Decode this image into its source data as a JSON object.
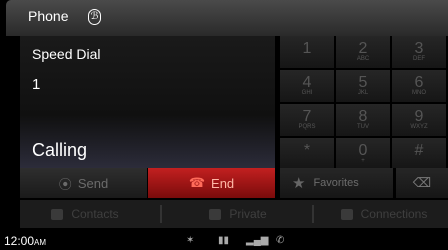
{
  "header": {
    "title": "Phone",
    "bluetooth_icon": "bluetooth-icon"
  },
  "left_panel": {
    "label": "Speed Dial",
    "number": "1",
    "status": "Calling"
  },
  "actions": {
    "send_label": "Send",
    "end_label": "End",
    "end_color": "#c22020"
  },
  "keypad": {
    "keys": [
      {
        "digit": "1",
        "letters": ""
      },
      {
        "digit": "2",
        "letters": "ABC"
      },
      {
        "digit": "3",
        "letters": "DEF"
      },
      {
        "digit": "4",
        "letters": "GHI"
      },
      {
        "digit": "5",
        "letters": "JKL"
      },
      {
        "digit": "6",
        "letters": "MNO"
      },
      {
        "digit": "7",
        "letters": "PQRS"
      },
      {
        "digit": "8",
        "letters": "TUV"
      },
      {
        "digit": "9",
        "letters": "WXYZ"
      },
      {
        "digit": "*",
        "letters": ""
      },
      {
        "digit": "0",
        "letters": "+"
      },
      {
        "digit": "#",
        "letters": ""
      }
    ],
    "favorites_label": "Favorites"
  },
  "tabs": [
    {
      "label": "Contacts",
      "icon": "contacts-icon"
    },
    {
      "label": "Private",
      "icon": "private-icon"
    },
    {
      "label": "Connections",
      "icon": "connections-icon"
    }
  ],
  "statusbar": {
    "time": "12:00",
    "ampm": "AM"
  }
}
